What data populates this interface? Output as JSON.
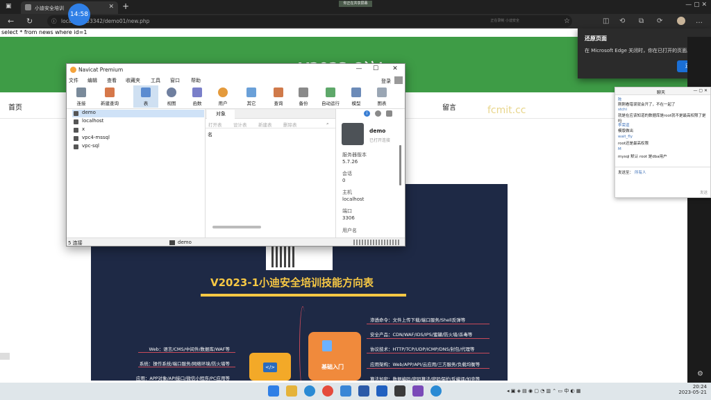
{
  "browser": {
    "tab_title": "小迪安全培训",
    "tab_close": "✕",
    "new_tab": "+",
    "clock_badge": "14:58",
    "share_badge": "你正在共享屏幕",
    "url": "localhost:53342/demo01/new.php",
    "url_prefix": "loca",
    "url_hint": "正在录制 小迪安全",
    "window_controls": "— ▢ ✕"
  },
  "page": {
    "sql_text": "select * from news where id=1",
    "site_heading": "V2023-8访！",
    "nav": {
      "home": "首页",
      "message": "留言"
    },
    "watermark": "fcmit.cc",
    "poster": {
      "title": "V2023-1小迪安全培训技能方向表",
      "center_label": "基础入门",
      "right_items": [
        "渗透命令：文件上传下载/端口服务/Shell反弹等",
        "安全产品：CDN/WAF/IDS/IPS/蜜罐/防火墙/杀毒等",
        "协议技术：HTTP/TCP/UDP/ICMP/DNS/封包/代理等",
        "应用架构：Web/APP/API/云应用/三方服务/负载均衡等",
        "算法加密：数据编码/密码算法/密码保护/反编译/加壳等"
      ],
      "left_items": [
        "Web：语言/CMS/中间件/数据库/WAF等",
        "系统：操作系统/端口服务/网络环境/防火墙等",
        "应用：APP对象/API接口/微信小程序/PC应用等"
      ]
    }
  },
  "navicat": {
    "title": "Navicat Premium",
    "window_buttons": {
      "min": "—",
      "max": "☐",
      "close": "✕"
    },
    "menu": [
      "文件",
      "编辑",
      "查看",
      "收藏夹",
      "工具",
      "窗口",
      "帮助"
    ],
    "login": "登录",
    "toolbar": [
      "连接",
      "新建查询",
      "表",
      "视图",
      "函数",
      "用户",
      "其它",
      "查询",
      "备份",
      "自动运行",
      "模型",
      "图表"
    ],
    "connections": [
      "demo",
      "localhost",
      "x",
      "vpc4-mssql",
      "vpc-sql"
    ],
    "object_tab": "对象",
    "object_actions": [
      "打开表",
      "设计表",
      "新建表",
      "删除表"
    ],
    "column_header": "名",
    "info": {
      "name": "demo",
      "status": "已打开连接",
      "server_version_label": "服务器版本",
      "server_version": "5.7.26",
      "session_label": "会话",
      "session": "0",
      "host_label": "主机",
      "host": "localhost",
      "port_label": "端口",
      "port": "3306",
      "user_label": "用户名"
    },
    "status_left": "5 连接",
    "status_db": "demo"
  },
  "restore_popup": {
    "heading": "还原页面",
    "body": "在 Microsoft Edge 关闭时，你在已打开的页面。",
    "button": "还原"
  },
  "chat": {
    "title": "聊天",
    "messages": [
      {
        "name": "陈",
        "text": "刚刚看错误就会开了，不在一起了"
      },
      {
        "name": "stchi",
        "text": "就是在应该知道的数据库是root就不是最高权限了是吗"
      },
      {
        "name": "李荣道",
        "text": "模版做出"
      },
      {
        "name": "wait_fly",
        "text": "root还是最高权限"
      },
      {
        "name": "M",
        "text": "mysql 默认 root 是dba用户"
      }
    ],
    "send_to_label": "发送至：",
    "send_to_value": "所有人",
    "send_button": "发送"
  },
  "taskbar": {
    "tray_lang": "中",
    "time": "20:24",
    "date": "2023-05-21"
  }
}
